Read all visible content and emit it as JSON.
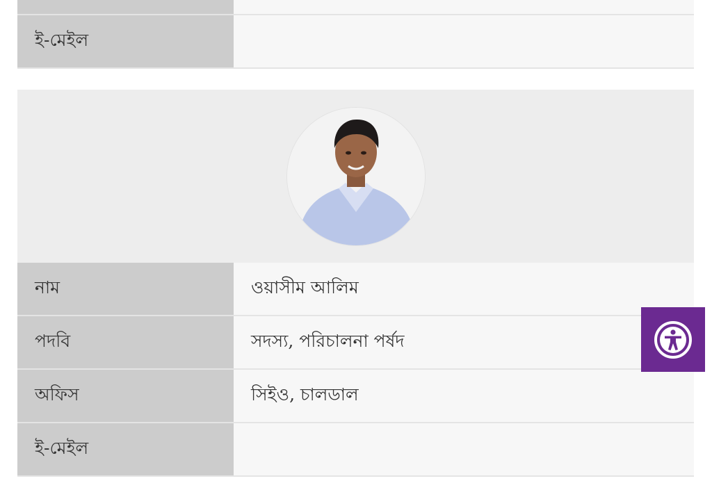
{
  "previous_member": {
    "email_label": "ই-মেইল",
    "email_value": ""
  },
  "member": {
    "photo": "member-photo",
    "rows": [
      {
        "label": "নাম",
        "value": "ওয়াসীম আলিম"
      },
      {
        "label": "পদবি",
        "value": "সদস্য, পরিচালনা পর্ষদ"
      },
      {
        "label": "অফিস",
        "value": "সিইও, চালডাল"
      },
      {
        "label": "ই-মেইল",
        "value": ""
      }
    ]
  },
  "accessibility": {
    "icon": "accessibility-icon",
    "color": "#6b2a91"
  }
}
